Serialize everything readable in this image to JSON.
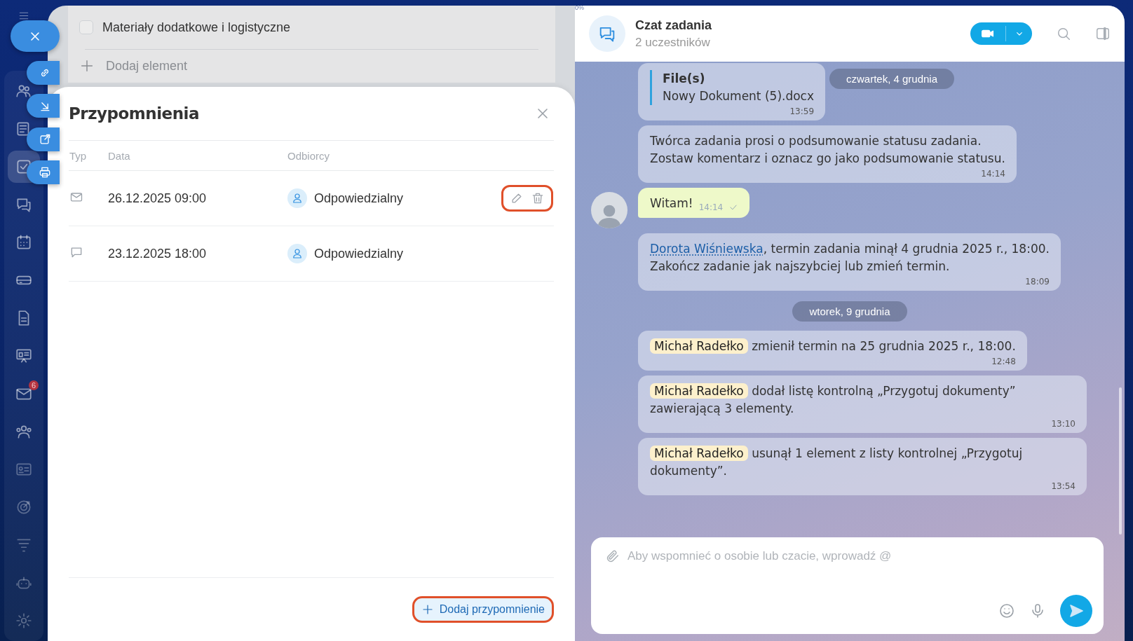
{
  "top_label": "0%",
  "sidebar": {
    "items": [
      {
        "kind": "group",
        "selected": false
      },
      {
        "kind": "news",
        "selected": false
      },
      {
        "kind": "tasks",
        "selected": true
      },
      {
        "kind": "chat",
        "selected": false
      },
      {
        "kind": "calendar",
        "selected": false
      },
      {
        "kind": "drive",
        "selected": false
      },
      {
        "kind": "document",
        "selected": false
      },
      {
        "kind": "board",
        "selected": false
      },
      {
        "kind": "mail",
        "selected": false,
        "badge": "6"
      },
      {
        "kind": "contacts",
        "selected": false
      },
      {
        "kind": "card",
        "selected": false
      },
      {
        "kind": "target",
        "selected": false
      },
      {
        "kind": "funnel",
        "selected": false
      },
      {
        "kind": "robot",
        "selected": false
      },
      {
        "kind": "gear",
        "selected": false
      }
    ]
  },
  "checklist": {
    "items": [
      {
        "label": "Materiały dodatkowe i logistyczne",
        "checked": false
      }
    ],
    "add_label": "Dodaj element"
  },
  "reminders": {
    "title": "Przypomnienia",
    "columns": [
      "Typ",
      "Data",
      "Odbiorcy"
    ],
    "rows": [
      {
        "kind": "email",
        "date": "26.12.2025 09:00",
        "recipient": "Odpowiedzialny",
        "hovered": true
      },
      {
        "kind": "chat",
        "date": "23.12.2025 18:00",
        "recipient": "Odpowiedzialny",
        "hovered": false
      }
    ],
    "add_button": "Dodaj przypomnienie"
  },
  "chat": {
    "title": "Czat zadania",
    "subtitle": "2 uczestników",
    "messages": [
      {
        "kind": "file",
        "heading": "File(s)",
        "text": "Nowy Dokument (5).docx",
        "time": "13:59"
      },
      {
        "kind": "date",
        "text": "czwartek, 4 grudnia",
        "pinned": true
      },
      {
        "kind": "system",
        "text": "Twórca zadania prosi o podsumowanie statusu zadania.\nZostaw komentarz i oznacz go jako podsumowanie statusu.",
        "time": "14:14"
      },
      {
        "kind": "own",
        "text": "Witam!",
        "time": "14:14",
        "read": true
      },
      {
        "kind": "system",
        "link": "Dorota Wiśniewska",
        "text": ", termin zadania minął 4 grudnia 2025 r., 18:00.\nZakończ zadanie jak najszybciej lub zmień termin.",
        "time": "18:09"
      },
      {
        "kind": "date",
        "text": "wtorek, 9 grudnia"
      },
      {
        "kind": "system",
        "user": "Michał Radełko",
        "text": " zmienił termin na 25 grudnia 2025 r., 18:00.",
        "time": "12:48"
      },
      {
        "kind": "system",
        "user": "Michał Radełko",
        "text": " dodał listę kontrolną „Przygotuj dokumenty” zawierającą 3 elementy.",
        "time": "13:10"
      },
      {
        "kind": "system",
        "user": "Michał Radełko",
        "text": " usunął 1 element z listy kontrolnej „Przygotuj dokumenty”.",
        "time": "13:54"
      }
    ],
    "composer": {
      "placeholder": "Aby wspomnieć o osobie lub czacie, wprowadź @"
    }
  }
}
